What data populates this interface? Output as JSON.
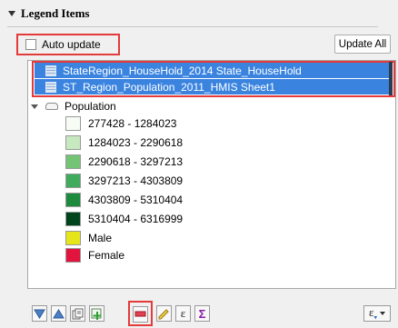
{
  "section": {
    "title": "Legend Items"
  },
  "controls": {
    "auto_update_label": "Auto update",
    "auto_update_checked": false,
    "update_all_label": "Update All"
  },
  "layers": [
    {
      "label": "StateRegion_HouseHold_2014 State_HouseHold",
      "icon": "table-icon",
      "selected": true
    },
    {
      "label": "ST_Region_Population_2011_HMIS Sheet1",
      "icon": "table-icon",
      "selected": true
    }
  ],
  "group": {
    "label": "Population",
    "icon": "polygon-layer-icon"
  },
  "legend_items": [
    {
      "label": "277428 - 1284023",
      "color": "#f7fcf5"
    },
    {
      "label": "1284023 - 2290618",
      "color": "#c7e9c0"
    },
    {
      "label": "2290618 - 3297213",
      "color": "#74c476"
    },
    {
      "label": "3297213 - 4303809",
      "color": "#41ab5d"
    },
    {
      "label": "4303809 - 5310404",
      "color": "#1e8a3e"
    },
    {
      "label": "5310404 - 6316999",
      "color": "#00441b"
    },
    {
      "label": "Male",
      "color": "#e5e51a"
    },
    {
      "label": "Female",
      "color": "#e0143c"
    }
  ],
  "toolbar": [
    {
      "name": "move-down-button",
      "icon": "arrow-down-icon"
    },
    {
      "name": "move-up-button",
      "icon": "arrow-up-icon"
    },
    {
      "name": "add-group-button",
      "icon": "add-group-icon"
    },
    {
      "name": "add-layer-button",
      "icon": "add-layer-icon"
    },
    {
      "name": "remove-item-button",
      "icon": "remove-icon"
    },
    {
      "name": "edit-item-button",
      "icon": "pencil-icon"
    },
    {
      "name": "expression-button",
      "icon": "epsilon-icon"
    },
    {
      "name": "count-button",
      "icon": "sigma-icon"
    },
    {
      "name": "filter-expression-button",
      "icon": "filter-epsilon-icon"
    }
  ],
  "colors": {
    "selection": "#3a84e0",
    "highlight": "#e43a3a"
  }
}
